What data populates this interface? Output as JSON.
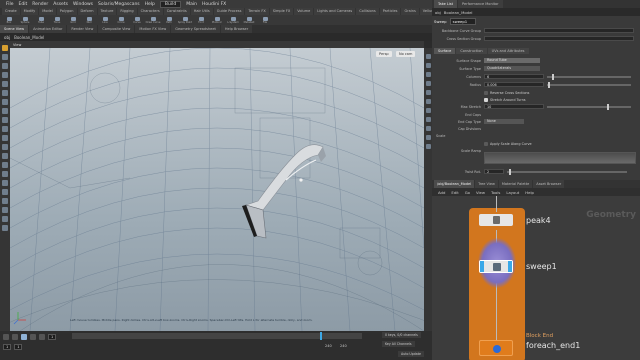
{
  "menubar": {
    "items": [
      "File",
      "Edit",
      "Render",
      "Assets",
      "Windows",
      "Solaris/Megascans",
      "Help"
    ],
    "build_field": "Build",
    "tabs": [
      "Main",
      "Houdini FX"
    ]
  },
  "shelf": {
    "tabs": [
      "Create",
      "Modify",
      "Model",
      "Polygon",
      "Deform",
      "Texture",
      "Rigging",
      "Characters",
      "Constraints",
      "Hair Utils",
      "Guide Process",
      "Terrain FX",
      "Simple FX",
      "Volume",
      "Lights and Cameras",
      "Collisions",
      "Particles",
      "Grains",
      "Vellum",
      "Rigid Bodies",
      "Particle Fluids",
      "Viscous Fluids"
    ],
    "tools": [
      "Box",
      "Sphere",
      "Tube",
      "Torus",
      "Grid",
      "Null",
      "Line",
      "Circle",
      "Curve",
      "Draw Curve",
      "Path",
      "Spray Paint",
      "Font",
      "Platonic",
      "L-System",
      "Metaball",
      "File"
    ]
  },
  "viewport": {
    "tabs": [
      "Scene View",
      "Animation Editor",
      "Render View",
      "Composite View",
      "Motion FX View",
      "Geometry Spreadsheet",
      "Help Browser"
    ],
    "active_tab": "Scene View",
    "path_obj": "obj",
    "path_node": "Boolean_Model",
    "header_label": "View",
    "buttons": [
      "Persp",
      "No cam"
    ],
    "status": "Left mouse tumbles. Middle pans. Right dollies. Ctrl+Alt+Left box-zooms. Ctrl+Right zooms. Spacebar-Ctrl-Left tilts. Hold L for alternate tumble, dolly, and zoom."
  },
  "timeline": {
    "frame": "1",
    "start": "1",
    "end": "240",
    "end2": "240",
    "keys_label": "0 keys, 0/0 channels",
    "key_all_label": "Key All Channels",
    "auto_update": "Auto Update"
  },
  "param_pane": {
    "tabs": [
      "Take List",
      "Performance Monitor"
    ],
    "path_obj": "obj",
    "path_node": "Boolean_Model",
    "node_type": "Sweep",
    "node_name": "sweep1",
    "rows_top": [
      {
        "label": "Backbone Curve Group",
        "value": ""
      },
      {
        "label": "Cross Section Group",
        "value": ""
      }
    ],
    "sub_tabs": [
      "Surface",
      "Construction",
      "UVs and Attributes"
    ],
    "active_sub_tab": "Surface",
    "surface_shape_label": "Surface Shape",
    "surface_shape_value": "Round Tube",
    "surface_type_label": "Surface Type",
    "surface_type_value": "Quadrilaterals",
    "columns_label": "Columns",
    "columns_value": "6",
    "radius_label": "Radius",
    "radius_value": "0.006",
    "reverse_cross_label": "Reverse Cross Sections",
    "stretch_label": "Stretch Around Turns",
    "max_stretch_label": "Max Stretch",
    "max_stretch_value": "10",
    "end_caps_label": "End Caps",
    "end_cap_type_label": "End Cap Type",
    "end_cap_type_value": "None",
    "cap_divisions_label": "Cap Divisions",
    "scale_label": "Scale",
    "apply_scale_label": "Apply Scale Along Curve",
    "scale_ramp_label": "Scale Ramp",
    "twist_label": "Twist Rot.",
    "twist_value": "2"
  },
  "network": {
    "tabs": [
      "/obj/Boolean_Model",
      "Tree View",
      "Material Palette",
      "Asset Browser"
    ],
    "menu": [
      "Add",
      "Edit",
      "Go",
      "View",
      "Tools",
      "Layout",
      "Help"
    ],
    "context_label": "Geometry",
    "nodes": [
      {
        "name": "peak4"
      },
      {
        "name": "sweep1"
      },
      {
        "name": "foreach_end1",
        "sublabel": "Block End"
      }
    ]
  }
}
